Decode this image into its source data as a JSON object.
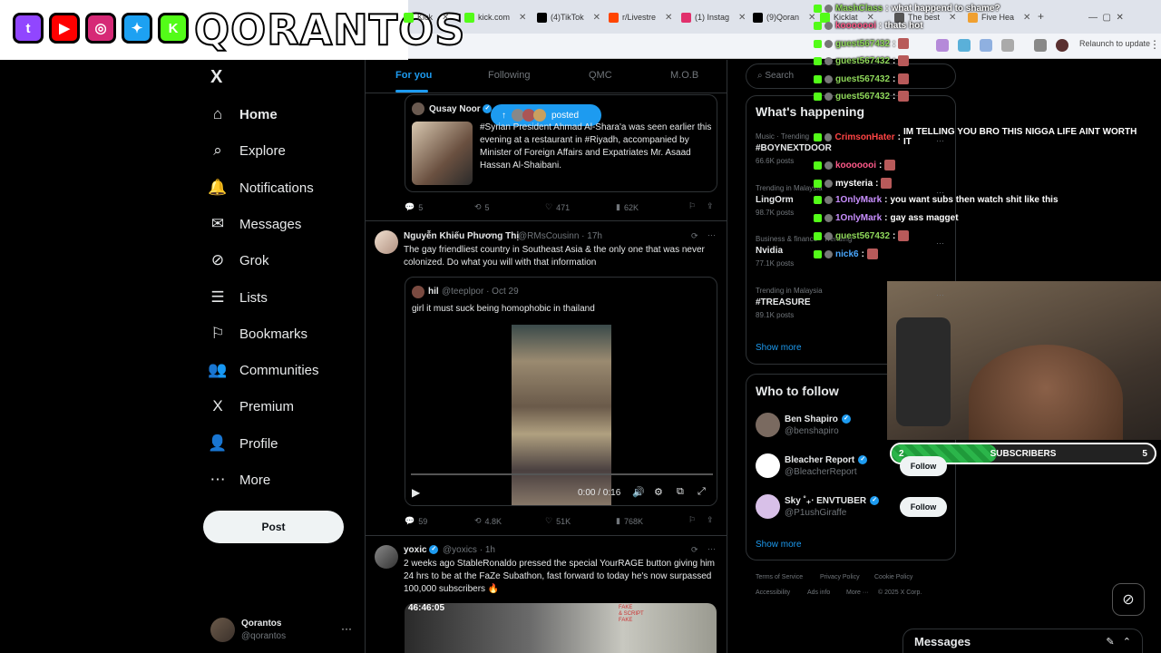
{
  "browser": {
    "tabs": [
      {
        "label": "Kick",
        "color": "#53fc18"
      },
      {
        "label": "kick.com",
        "color": "#53fc18"
      },
      {
        "label": "(4)TikTok",
        "color": "#000000"
      },
      {
        "label": "r/Livestre",
        "color": "#ff4500"
      },
      {
        "label": "(1) Instag",
        "color": "#e1306c"
      },
      {
        "label": "(9)Qoran",
        "color": "#000000"
      },
      {
        "label": "Kicklat",
        "color": "#53fc18"
      },
      {
        "label": "The best",
        "color": "#555555"
      },
      {
        "label": "Five Hea",
        "color": "#f0a030"
      }
    ],
    "relaunch_label": "Relaunch to update"
  },
  "banner": {
    "brand": "QORANTOS",
    "socials": [
      {
        "icon": "twitch-icon",
        "glyph": "t",
        "color": "#9146ff"
      },
      {
        "icon": "youtube-icon",
        "glyph": "▶",
        "color": "#ff0000"
      },
      {
        "icon": "instagram-icon",
        "glyph": "◎",
        "color": "#d62976"
      },
      {
        "icon": "twitter-icon",
        "glyph": "✦",
        "color": "#1da1f2"
      },
      {
        "icon": "kick-icon",
        "glyph": "K",
        "color": "#53fc18"
      }
    ]
  },
  "nav": {
    "logo": "X",
    "items": [
      {
        "label": "Home",
        "icon": "home-icon",
        "glyph": "⌂",
        "active": true
      },
      {
        "label": "Explore",
        "icon": "search-icon",
        "glyph": "⌕"
      },
      {
        "label": "Notifications",
        "icon": "bell-icon",
        "glyph": "🔔"
      },
      {
        "label": "Messages",
        "icon": "mail-icon",
        "glyph": "✉"
      },
      {
        "label": "Grok",
        "icon": "grok-icon",
        "glyph": "⊘"
      },
      {
        "label": "Lists",
        "icon": "list-icon",
        "glyph": "☰"
      },
      {
        "label": "Bookmarks",
        "icon": "bookmark-icon",
        "glyph": "⚐"
      },
      {
        "label": "Communities",
        "icon": "communities-icon",
        "glyph": "👥"
      },
      {
        "label": "Premium",
        "icon": "premium-icon",
        "glyph": "X"
      },
      {
        "label": "Profile",
        "icon": "profile-icon",
        "glyph": "👤"
      },
      {
        "label": "More",
        "icon": "more-icon",
        "glyph": "⋯"
      }
    ],
    "post_label": "Post",
    "account": {
      "name": "Qorantos",
      "handle": "@qorantos"
    }
  },
  "feed": {
    "tabs": [
      "For you",
      "Following",
      "QMC",
      "M.O.B"
    ],
    "posted_pill": "posted",
    "tweets": [
      {
        "name": "Qusay Noor",
        "text": "#Syrian President Ahmad Al-Shara'a was seen earlier this evening at a restaurant in #Riyadh, accompanied by Minister of Foreign Affairs and Expatriates Mr. Asaad Hassan Al-Shaibani.",
        "replies": "5",
        "reposts": "5",
        "likes": "471",
        "views": "62K"
      },
      {
        "name": "Nguyễn Khiếu Phương Thị",
        "handle": "@RMsCousinn · 17h",
        "text": "The gay friendliest country in Southeast Asia & the only one that was never colonized. Do what you will with that information",
        "quote": {
          "name": "hil",
          "handle": "@teeplpor · Oct 29",
          "text": "girl it must suck being homophobic in thailand",
          "video_time": "0:00 / 0:16"
        },
        "replies": "59",
        "reposts": "4.8K",
        "likes": "51K",
        "views": "768K"
      },
      {
        "name": "yoxic",
        "handle": "@yoxics · 1h",
        "text": "2 weeks ago StableRonaldo pressed the special YourRAGE button giving him 24 hrs to be at the FaZe Subathon, fast forward to today he's now surpassed 100,000 subscribers 🔥",
        "media_time": "46:46:05",
        "media_caption": "FAKE\n& SCRIPT\nFAKE"
      }
    ]
  },
  "right": {
    "search_placeholder": "Search",
    "happening_title": "What's happening",
    "trends": [
      {
        "category": "Music · Trending",
        "name": "#BOYNEXTDOOR",
        "count": "66.6K posts"
      },
      {
        "category": "Trending in Malaysia",
        "name": "LingOrm",
        "count": "98.7K posts"
      },
      {
        "category": "Business & finance · Trending",
        "name": "Nvidia",
        "count": "77.1K posts"
      },
      {
        "category": "Trending in Malaysia",
        "name": "#TREASURE",
        "count": "89.1K posts"
      }
    ],
    "show_more": "Show more",
    "follow_title": "Who to follow",
    "follow": [
      {
        "name": "Ben Shapiro",
        "handle": "@benshapiro",
        "button": ""
      },
      {
        "name": "Bleacher Report",
        "handle": "@BleacherReport",
        "button": "Follow"
      },
      {
        "name": "Sky ˚₊‧ ENVTUBER",
        "handle": "@P1ushGiraffe",
        "button": "Follow"
      }
    ],
    "footer": [
      "Terms of Service",
      "Privacy Policy",
      "Cookie Policy",
      "Accessibility",
      "Ads info",
      "More ···",
      "© 2025 X Corp."
    ],
    "messages_label": "Messages"
  },
  "chat": [
    {
      "user": "MashClass",
      "msg": "what happend to shame?",
      "color": "#8fd85a"
    },
    {
      "user": "kooooooi",
      "msg": "thats hot",
      "color": "#ff5a8a"
    },
    {
      "user": "guest567432",
      "msg": "",
      "color": "#8fd85a"
    },
    {
      "user": "guest567432",
      "msg": "",
      "color": "#8fd85a"
    },
    {
      "user": "guest567432",
      "msg": "",
      "color": "#8fd85a"
    },
    {
      "user": "guest567432",
      "msg": "",
      "color": "#8fd85a"
    },
    {
      "user": "CrimsonHater",
      "msg": "IM TELLING YOU BRO THIS NIGGA LIFE AINT WORTH IT",
      "color": "#ff4444"
    },
    {
      "user": "kooooooi",
      "msg": "",
      "color": "#ff5a8a"
    },
    {
      "user": "mysteria",
      "msg": "",
      "color": "#ffffff"
    },
    {
      "user": "1OnlyMark",
      "msg": "you want subs then watch shit like this",
      "color": "#c98fff"
    },
    {
      "user": "1OnlyMark",
      "msg": "gay ass magget",
      "color": "#c98fff"
    },
    {
      "user": "guest567432",
      "msg": "",
      "color": "#8fd85a"
    },
    {
      "user": "nick6",
      "msg": "",
      "color": "#4aa8ff"
    }
  ],
  "subgoal": {
    "current": "2",
    "label": "SUBSCRIBERS",
    "target": "5",
    "progress": 0.4
  }
}
